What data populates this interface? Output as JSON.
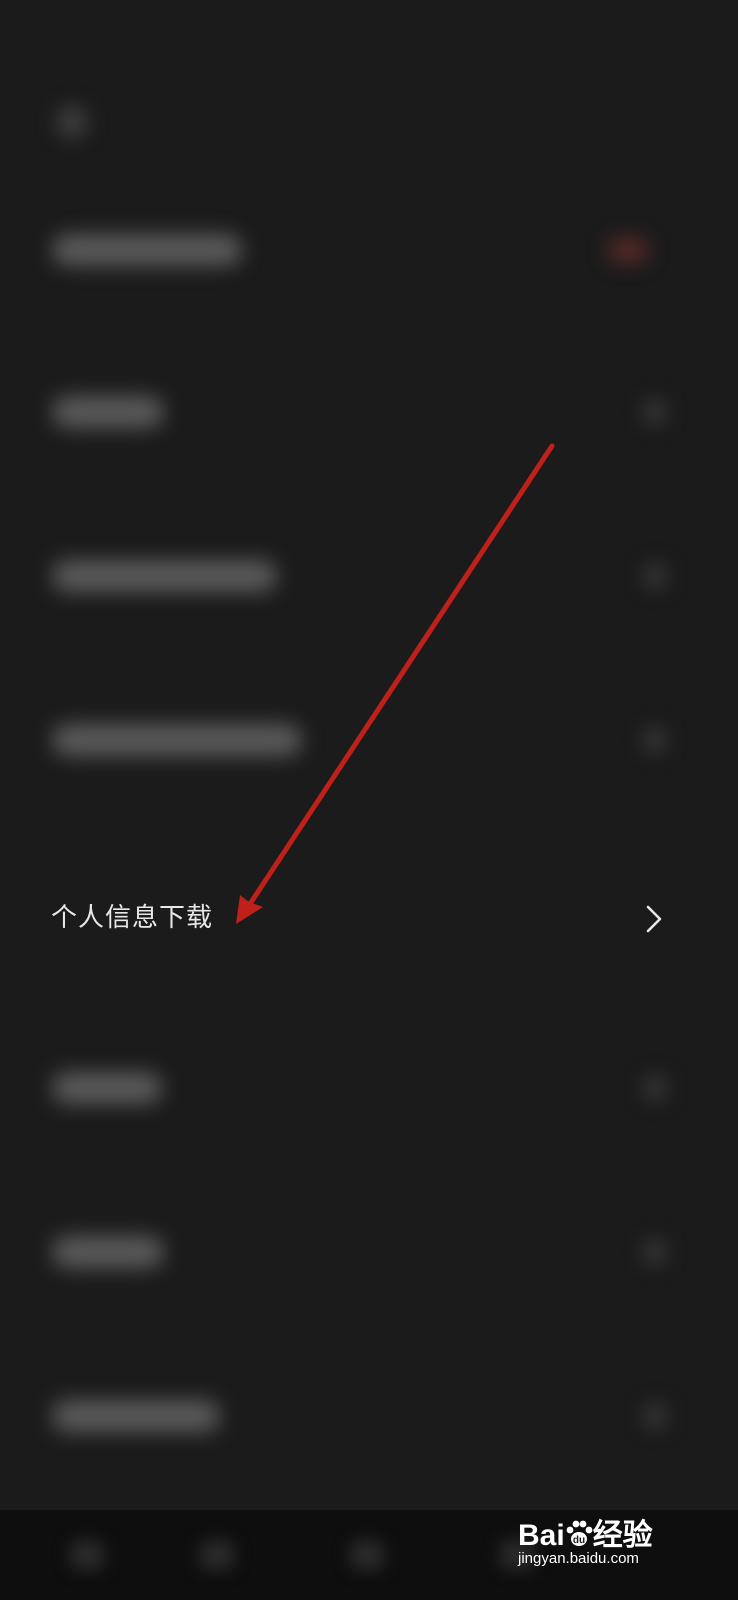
{
  "header": {
    "back_icon": "back-arrow-icon"
  },
  "settings_rows": [
    {
      "label": "",
      "blurred": true,
      "has_badge": true
    },
    {
      "label": "",
      "blurred": true
    },
    {
      "label": "",
      "blurred": true
    },
    {
      "label": "",
      "blurred": true
    },
    {
      "label": "个人信息下载",
      "blurred": false
    },
    {
      "label": "",
      "blurred": true
    },
    {
      "label": "",
      "blurred": true
    },
    {
      "label": "",
      "blurred": true
    }
  ],
  "highlight_row": {
    "label": "个人信息下载",
    "chevron_icon": "chevron-right-icon"
  },
  "annotation": {
    "arrow_color": "#c0201a"
  },
  "watermark": {
    "brand_left": "Bai",
    "brand_right": "经验",
    "url": "jingyan.baidu.com"
  },
  "colors": {
    "background": "#1b1b1b",
    "text": "#e8e8e8"
  }
}
